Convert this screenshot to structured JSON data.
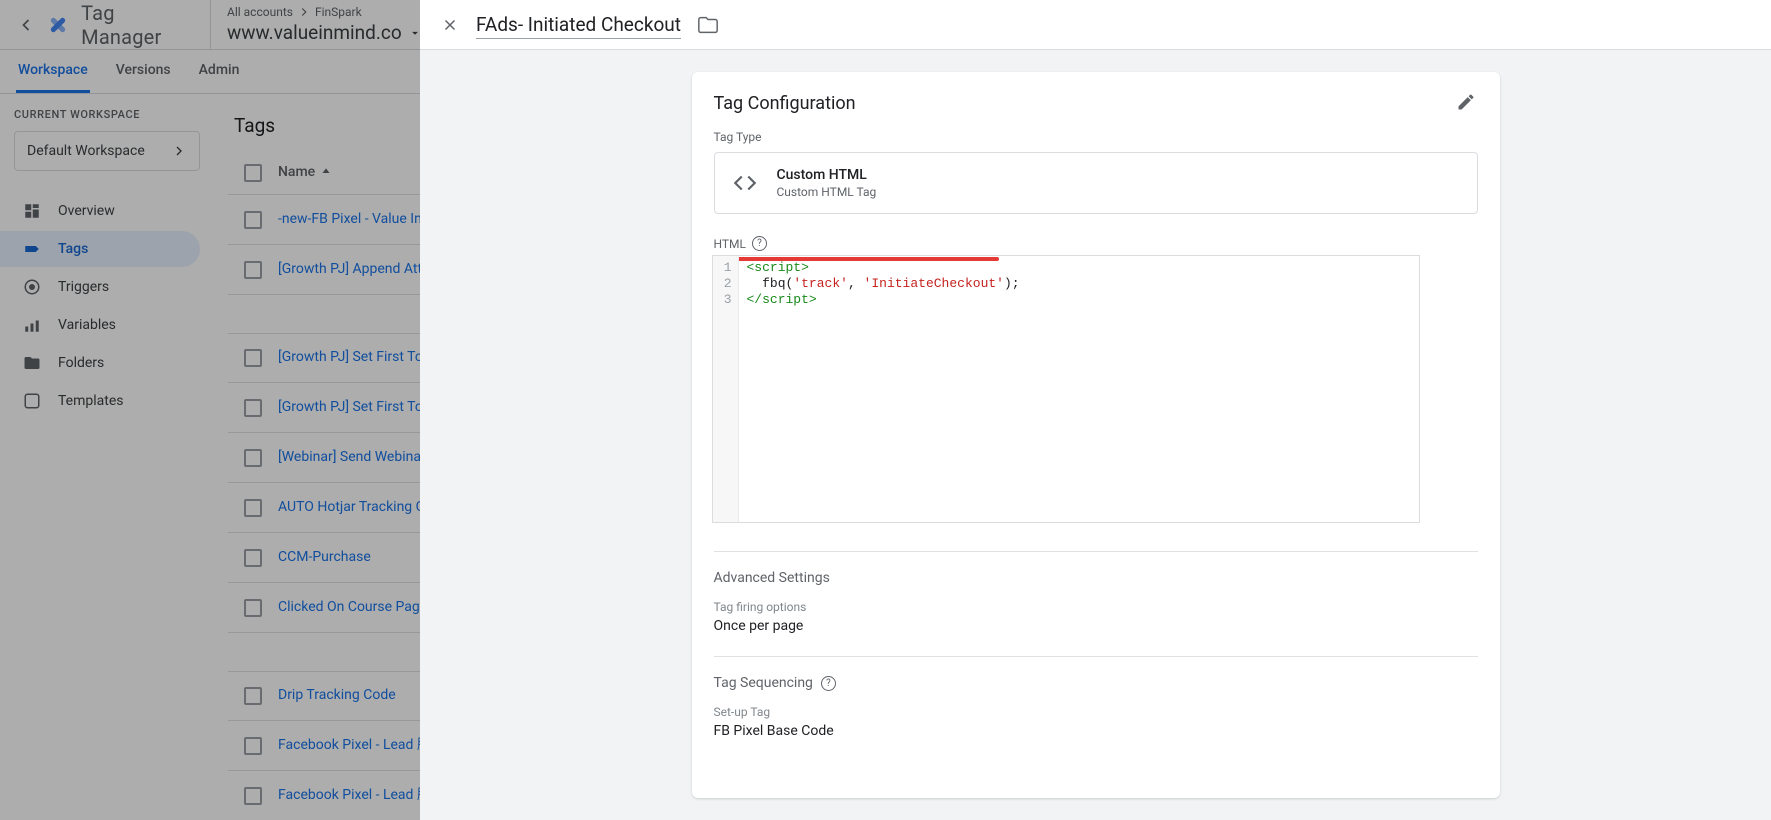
{
  "header": {
    "product_name": "Tag Manager",
    "breadcrumb_prefix": "All accounts",
    "breadcrumb_account": "FinSpark",
    "container_domain": "www.valueinmind.co"
  },
  "tabs": {
    "workspace": "Workspace",
    "versions": "Versions",
    "admin": "Admin"
  },
  "sidebar": {
    "current_ws_label": "CURRENT WORKSPACE",
    "workspace_name": "Default Workspace",
    "items": [
      {
        "label": "Overview"
      },
      {
        "label": "Tags"
      },
      {
        "label": "Triggers"
      },
      {
        "label": "Variables"
      },
      {
        "label": "Folders"
      },
      {
        "label": "Templates"
      }
    ]
  },
  "page_title": "Tags",
  "table": {
    "col_name": "Name",
    "rows": [
      "-new-FB Pixel - Value Investing Purchase",
      "[Growth PJ] Append Attribution Page Links",
      "[Growth PJ] Set First Touch Attribution - Cookies",
      "[Growth PJ] Set First Touch Attribution - For Thrive Leads",
      "[Webinar] Send Webinar Sign Up Tracking Sheet",
      "AUTO Hotjar Tracking Code",
      "CCM-Purchase",
      "Clicked On Course Page",
      "Drip Tracking Code",
      "Facebook Pixel - Lead 股票投資 Webinar",
      "Facebook Pixel - Lead 股票投資"
    ]
  },
  "panel": {
    "tag_name": "FAds- Initiated Checkout",
    "card_title": "Tag Configuration",
    "tag_type_label": "Tag Type",
    "tag_type_name": "Custom HTML",
    "tag_type_sub": "Custom HTML Tag",
    "html_label": "HTML",
    "code": {
      "lines": [
        "1",
        "2",
        "3"
      ],
      "l1_open": "<script>",
      "l2_indent": "  ",
      "l2_fn": "fbq",
      "l2_p1": "(",
      "l2_s1": "'track'",
      "l2_c": ", ",
      "l2_s2": "'InitiateCheckout'",
      "l2_p2": ");",
      "l3_close": "</script>"
    },
    "advanced_title": "Advanced Settings",
    "firing_label": "Tag firing options",
    "firing_value": "Once per page",
    "sequencing_title": "Tag Sequencing",
    "setup_label": "Set-up Tag",
    "setup_value": "FB Pixel Base Code"
  }
}
